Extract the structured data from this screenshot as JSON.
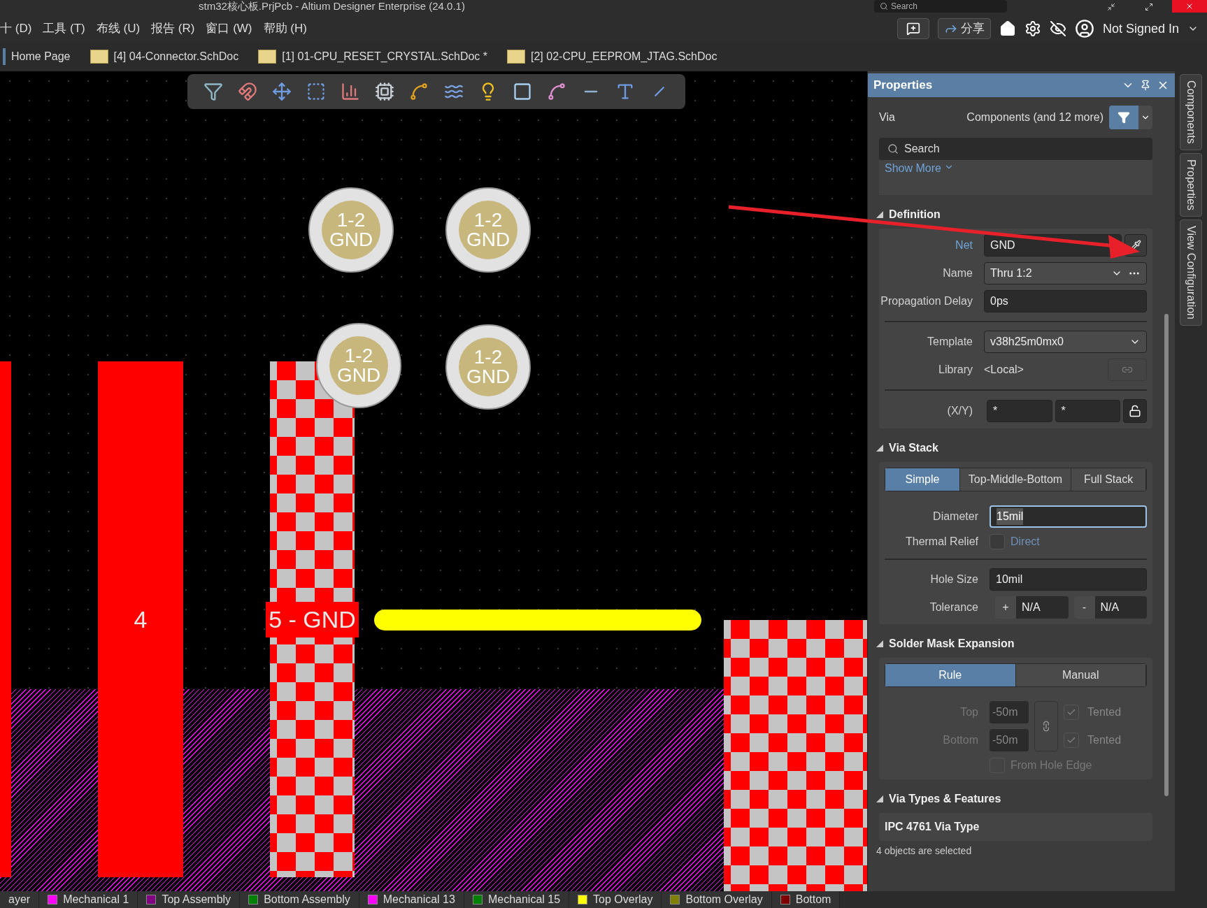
{
  "window": {
    "title": "stm32核心板.PrjPcb - Altium Designer Enterprise (24.0.1)",
    "search_placeholder": "Search"
  },
  "menu": [
    "十 (D)",
    "工具 (T)",
    "布线 (U)",
    "报告 (R)",
    "窗口 (W)",
    "帮助 (H)"
  ],
  "top_bar": {
    "share": "分享",
    "user": "Not Signed In"
  },
  "doc_tabs": [
    {
      "label": "Home Page",
      "kind": "home",
      "selected": false
    },
    {
      "label": "[4] 04-Connector.SchDoc",
      "kind": "sch",
      "selected": false
    },
    {
      "label": "[1] 01-CPU_RESET_CRYSTAL.SchDoc *",
      "kind": "sch",
      "selected": false
    },
    {
      "label": "[2] 02-CPU_EEPROM_JTAG.SchDoc",
      "kind": "sch",
      "selected": false
    }
  ],
  "canvas": {
    "vias": [
      {
        "span": "1-2",
        "net": "GND"
      },
      {
        "span": "1-2",
        "net": "GND"
      },
      {
        "span": "1-2",
        "net": "GND"
      },
      {
        "span": "1-2",
        "net": "GND"
      }
    ],
    "pads": [
      {
        "kind": "solid"
      },
      {
        "kind": "solid",
        "label": "4"
      },
      {
        "kind": "checker",
        "label": "5 - GND"
      },
      {
        "kind": "checker"
      }
    ]
  },
  "properties": {
    "title": "Properties",
    "object": "Via",
    "filter": "Components (and 12 more)",
    "search_placeholder": "Search",
    "show_more": "Show More",
    "definition": {
      "heading": "Definition",
      "expanded": true,
      "net_label": "Net",
      "net": "GND",
      "name_label": "Name",
      "name": "Thru 1:2",
      "delay_label": "Propagation Delay",
      "delay": "0ps",
      "template_label": "Template",
      "template": "v38h25m0mx0",
      "library_label": "Library",
      "library": "<Local>",
      "xy_label": "(X/Y)",
      "x": "*",
      "y": "*"
    },
    "via_stack": {
      "heading": "Via Stack",
      "expanded": true,
      "modes": [
        {
          "label": "Simple",
          "selected": true
        },
        {
          "label": "Top-Middle-Bottom",
          "selected": false
        },
        {
          "label": "Full Stack",
          "selected": false
        }
      ],
      "diameter_label": "Diameter",
      "diameter": "15mil",
      "thermal_label": "Thermal Relief",
      "thermal_checked": false,
      "thermal_option": "Direct",
      "hole_label": "Hole Size",
      "hole": "10mil",
      "tolerance_label": "Tolerance",
      "plus": "+",
      "plus_value": "N/A",
      "minus": "-",
      "minus_value": "N/A"
    },
    "solder_mask": {
      "heading": "Solder Mask Expansion",
      "expanded": true,
      "modes": [
        {
          "label": "Rule",
          "selected": true
        },
        {
          "label": "Manual",
          "selected": false
        }
      ],
      "rows": [
        {
          "label": "Top",
          "value": "-50m",
          "tented_label": "Tented",
          "tented": true
        },
        {
          "label": "Bottom",
          "value": "-50m",
          "tented_label": "Tented",
          "tented": true
        }
      ],
      "from_hole_edge_label": "From Hole Edge",
      "from_hole_edge": false
    },
    "via_types": {
      "heading": "Via Types & Features",
      "expanded": true,
      "ipc_label": "IPC 4761 Via Type"
    },
    "status": "4 objects are selected"
  },
  "side_tabs": [
    "Components",
    "Properties",
    "View Configuration"
  ],
  "layers": [
    {
      "label": "ayer"
    },
    {
      "label": "Mechanical 1",
      "color": "#ff00ff"
    },
    {
      "label": "Top Assembly",
      "color": "#800080"
    },
    {
      "label": "Bottom Assembly",
      "color": "#008000"
    },
    {
      "label": "Mechanical 13",
      "color": "#ff00ff"
    },
    {
      "label": "Mechanical 15",
      "color": "#008000"
    },
    {
      "label": "Top Overlay",
      "color": "#ffff00"
    },
    {
      "label": "Bottom Overlay",
      "color": "#808000"
    },
    {
      "label": "Bottom",
      "color": "#800000"
    }
  ]
}
